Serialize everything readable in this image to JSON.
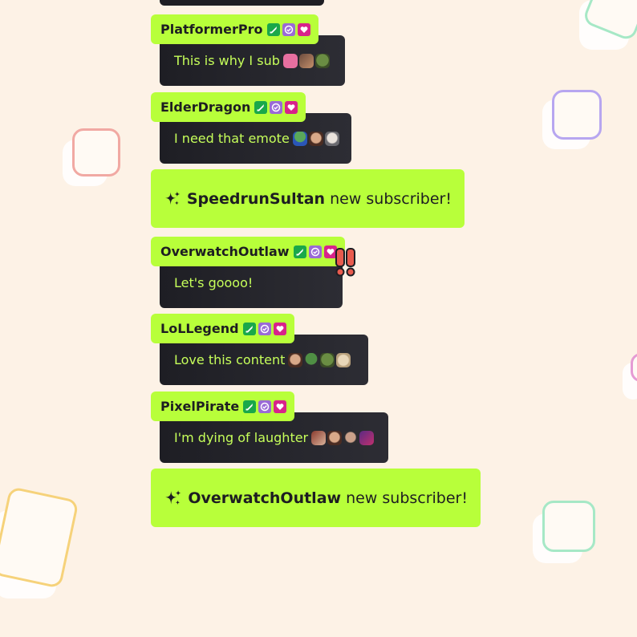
{
  "chat": {
    "messages": [
      {
        "user": "PlatformerPro",
        "text": "This is why I sub",
        "emotes": [
          "mascot-emote",
          "dancer-emote",
          "goblin-emote"
        ]
      },
      {
        "user": "ElderDragon",
        "text": "I need that emote",
        "emotes": [
          "frog-emote",
          "face-emote",
          "pale-face-emote"
        ]
      },
      {
        "user": "OverwatchOutlaw",
        "text": "Let's goooo!",
        "emotes": []
      },
      {
        "user": "LoLLegend",
        "text": "Love this content",
        "emotes": [
          "face-emote",
          "frog-emote",
          "goblin-emote",
          "cat-emote"
        ]
      },
      {
        "user": "PixelPirate",
        "text": "I'm dying of laughter",
        "emotes": [
          "hand-emote",
          "face-emote",
          "face-emote",
          "purple-emote"
        ]
      }
    ],
    "subscriptions": [
      {
        "user": "SpeedrunSultan",
        "text": "new subscriber!"
      },
      {
        "user": "OverwatchOutlaw",
        "text": "new subscriber!"
      }
    ],
    "badges": [
      "sword-badge-icon",
      "verified-badge-icon",
      "heart-badge-icon"
    ]
  },
  "colors": {
    "background": "#fdf2e6",
    "accent": "#b8ff3a",
    "bubble": "#1e1e24",
    "message_text": "#c6ff5a",
    "name_text": "#1d1d22"
  }
}
